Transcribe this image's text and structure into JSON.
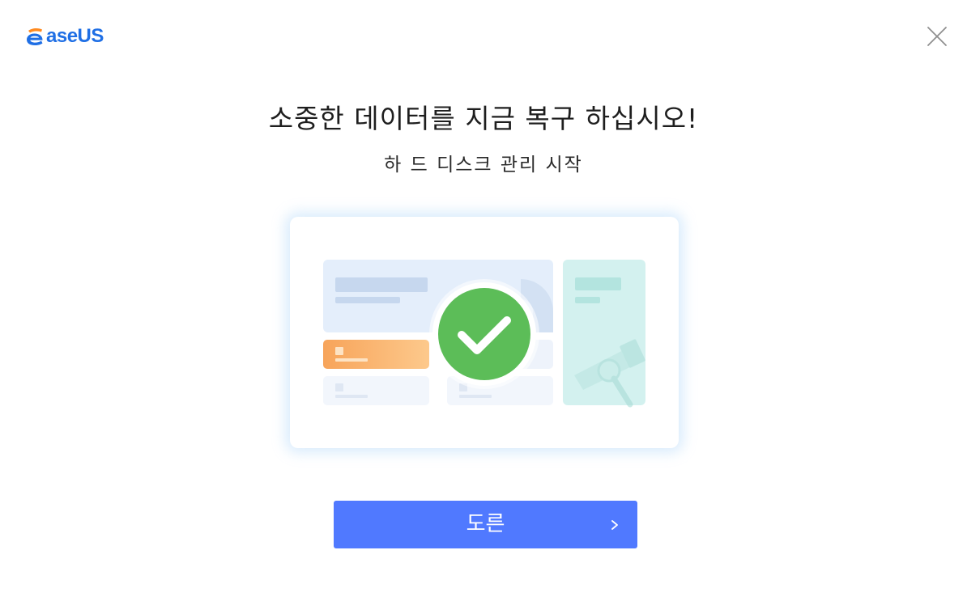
{
  "brand": {
    "name": "aseUS",
    "logo_icon": "easeus-e-logo",
    "color": "#1f6fe5",
    "accent": "#ff8a1f"
  },
  "window": {
    "close_icon": "close-icon"
  },
  "main": {
    "title": "소중한 데이터를 지금 복구 하십시오!",
    "subtitle": "하 드 디스크 관리 시작",
    "illustration_icon": "checkmark-success-icon"
  },
  "next_button": {
    "label": "도른",
    "icon": "chevron-right-icon",
    "color": "#5079ff"
  }
}
